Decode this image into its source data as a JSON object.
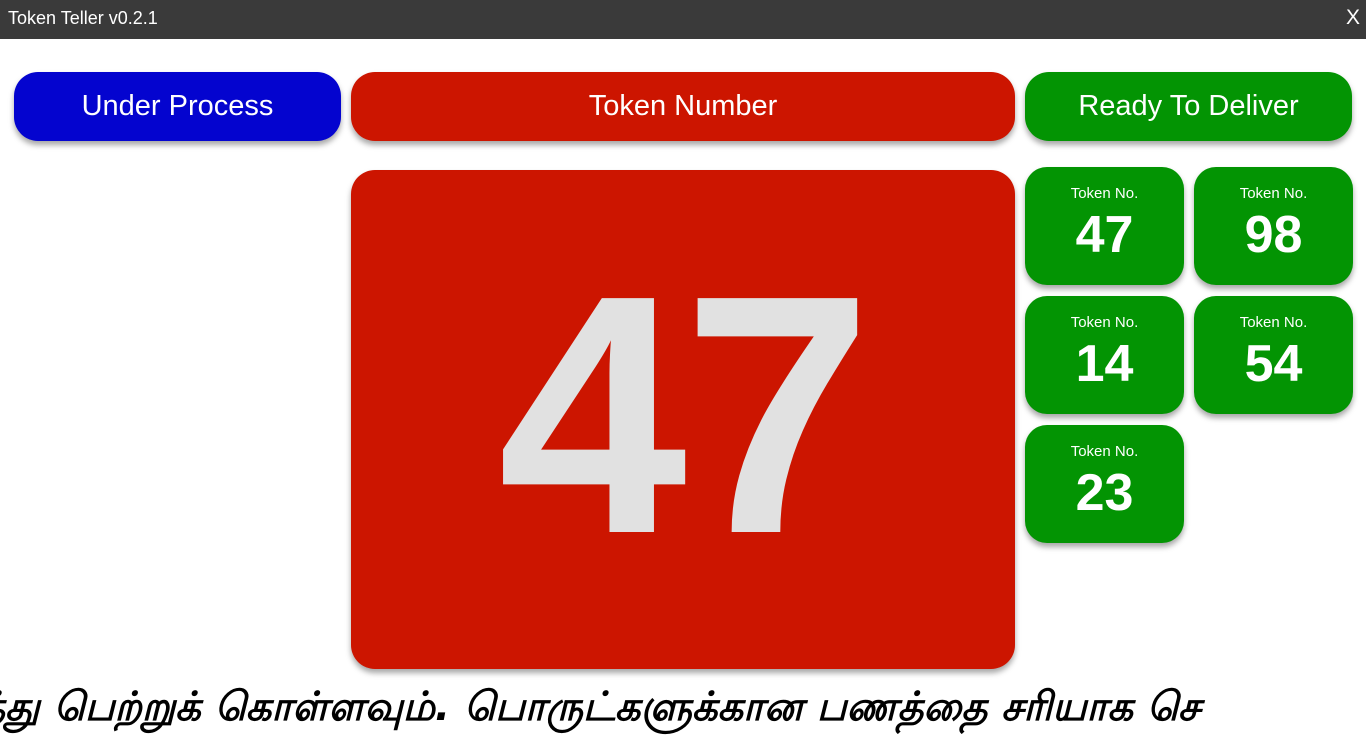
{
  "window": {
    "title": "Token Teller v0.2.1",
    "close_label": "X"
  },
  "headers": {
    "under_process": "Under Process",
    "token_number": "Token Number",
    "ready_to_deliver": "Ready To Deliver"
  },
  "current_token": "47",
  "ready_tokens": [
    {
      "label": "Token No.",
      "number": "47"
    },
    {
      "label": "Token No.",
      "number": "98"
    },
    {
      "label": "Token No.",
      "number": "14"
    },
    {
      "label": "Token No.",
      "number": "54"
    },
    {
      "label": "Token No.",
      "number": "23"
    }
  ],
  "ticker": {
    "text": "ர்த்து பெற்றுக் கொள்ளவும். பொருட்களுக்கான பணத்தை சரியாக செ"
  },
  "colors": {
    "titlebar": "#3a3a3a",
    "under_process": "#0404cf",
    "token_number": "#cc1500",
    "ready_to_deliver": "#039403",
    "big_number": "#e1e1e1"
  }
}
